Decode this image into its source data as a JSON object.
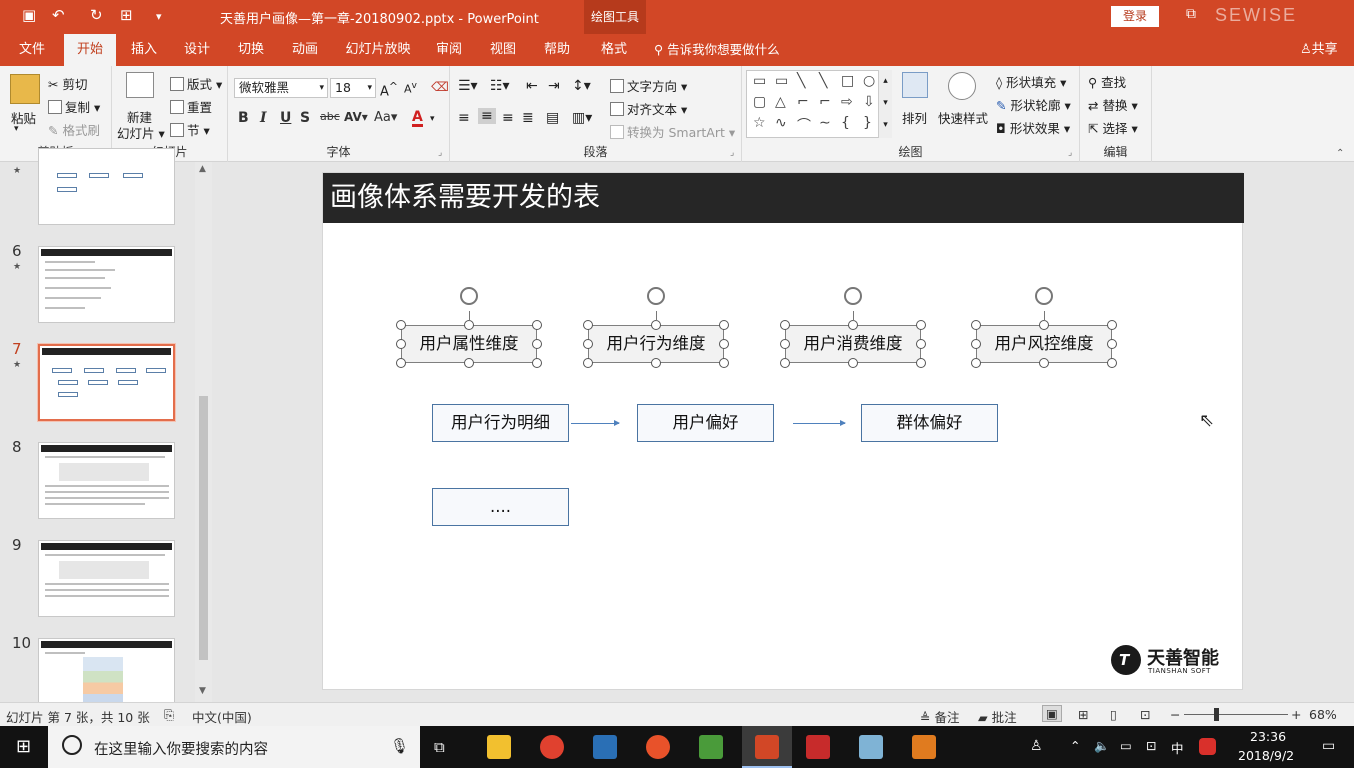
{
  "window": {
    "title": "天善用户画像—第一章-20180902.pptx  -  PowerPoint",
    "contextual_tab": "绘图工具",
    "login": "登录",
    "watermark": "SEWISE"
  },
  "tabs": [
    "文件",
    "开始",
    "插入",
    "设计",
    "切换",
    "动画",
    "幻灯片放映",
    "审阅",
    "视图",
    "帮助",
    "格式"
  ],
  "active_tab": "开始",
  "tell_me": "告诉我你想要做什么",
  "share": "共享",
  "ribbon": {
    "clipboard": {
      "label": "剪贴板",
      "paste": "粘贴",
      "cut": "剪切",
      "copy": "复制",
      "format_painter": "格式刷"
    },
    "slides": {
      "label": "幻灯片",
      "new_slide_1": "新建",
      "new_slide_2": "幻灯片",
      "layout": "版式",
      "reset": "重置",
      "section": "节"
    },
    "font": {
      "label": "字体",
      "name": "微软雅黑",
      "size": "18"
    },
    "paragraph": {
      "label": "段落",
      "text_direction": "文字方向",
      "align_text": "对齐文本",
      "smartart": "转换为 SmartArt"
    },
    "drawing": {
      "label": "绘图",
      "arrange": "排列",
      "quick_styles": "快速样式",
      "fill": "形状填充",
      "outline": "形状轮廓",
      "effects": "形状效果"
    },
    "editing": {
      "label": "编辑",
      "find": "查找",
      "replace": "替换",
      "select": "选择"
    }
  },
  "thumbnails": [
    {
      "num": "",
      "star": "★"
    },
    {
      "num": "6",
      "star": "★"
    },
    {
      "num": "7",
      "star": "★"
    },
    {
      "num": "8",
      "star": ""
    },
    {
      "num": "9",
      "star": ""
    },
    {
      "num": "10",
      "star": ""
    }
  ],
  "slide": {
    "title": "画像体系需要开发的表",
    "dimensions": [
      "用户属性维度",
      "用户行为维度",
      "用户消费维度",
      "用户风控维度"
    ],
    "flow": [
      "用户行为明细",
      "用户偏好",
      "群体偏好"
    ],
    "more": "....",
    "logo_cn": "天善智能",
    "logo_en": "TIANSHAN SOFT"
  },
  "status": {
    "slide_info": "幻灯片 第 7 张，共 10 张",
    "language": "中文(中国)",
    "notes": "备注",
    "comments": "批注",
    "zoom": "68%"
  },
  "taskbar": {
    "search_placeholder": "在这里输入你要搜索的内容",
    "ime": "中",
    "time": "23:36",
    "date": "2018/9/2"
  }
}
